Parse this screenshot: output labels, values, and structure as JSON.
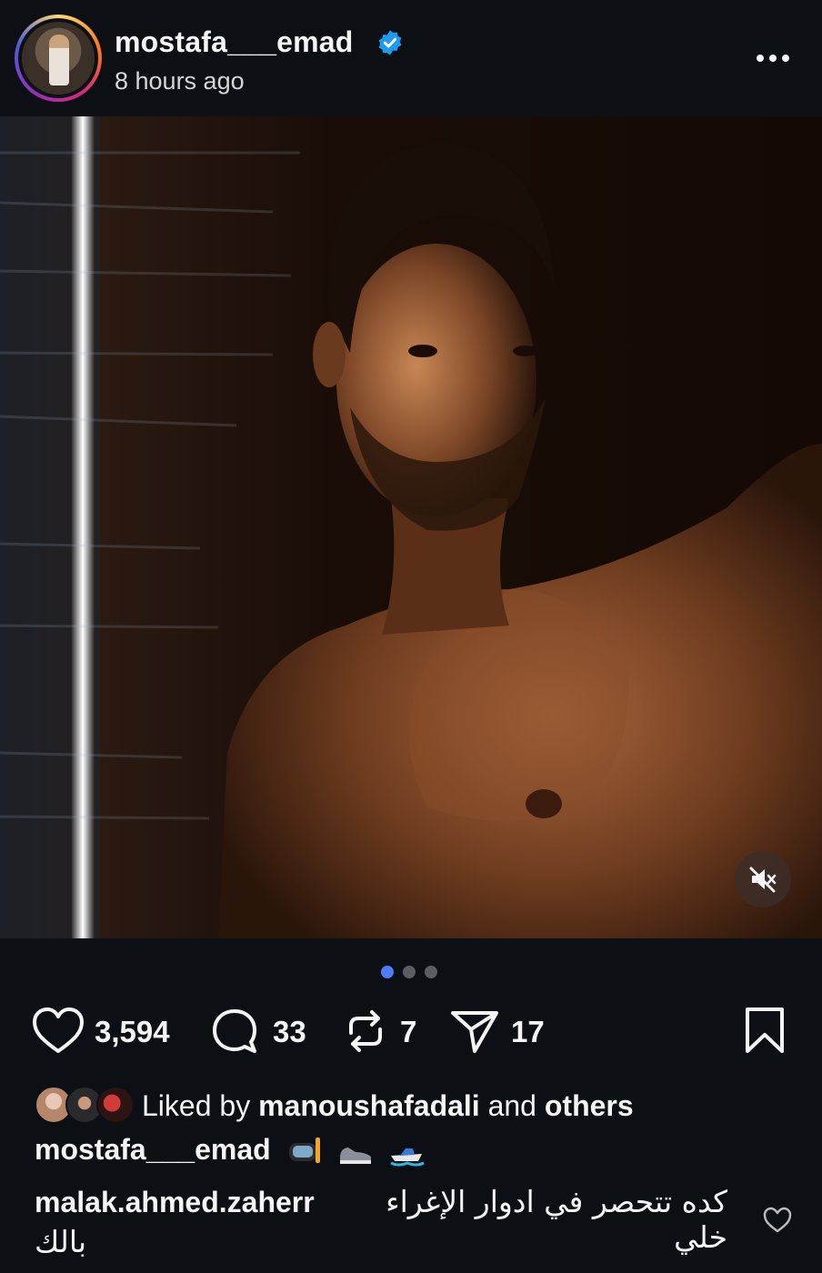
{
  "post": {
    "author": "mostafa___emad",
    "time": "8 hours ago"
  },
  "icons": {
    "verified": "verified-badge-icon",
    "more": "more-options-icon",
    "mute": "muted-speaker-icon",
    "like": "heart-icon",
    "comment": "comment-icon",
    "repost": "repost-icon",
    "share": "send-icon",
    "save": "bookmark-icon"
  },
  "carousel": {
    "count": 3,
    "active_index": 0
  },
  "actions": {
    "likes": "3,594",
    "comments": "33",
    "reposts": "7",
    "shares": "17"
  },
  "liked_by": {
    "prefix": "Liked by ",
    "user": "manoushafadali",
    "connector": " and ",
    "others": "others"
  },
  "caption": {
    "user": "mostafa___emad",
    "emojis": [
      "diving-mask",
      "sneaker",
      "speedboat"
    ]
  },
  "comment": {
    "user": "malak.ahmed.zaherr",
    "text_line1": "كده تتحصر في ادوار الإغراء خلي",
    "text_line2": "بالك"
  },
  "colors": {
    "background": "#0c1014",
    "verified": "#1d9bf0",
    "active_dot": "#4f7cf7"
  }
}
